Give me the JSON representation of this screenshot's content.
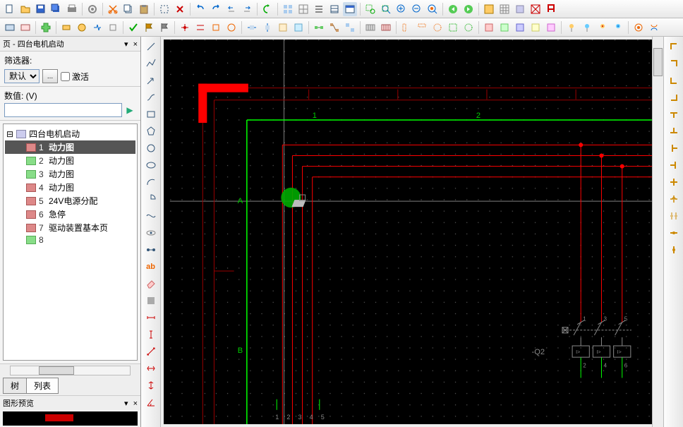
{
  "sidebar": {
    "panel_title": "页 - 四台电机启动",
    "filter_label": "筛选器:",
    "filter_select": "默认",
    "activate_label": "激活",
    "value_label": "数值: (V)",
    "value_input": "",
    "project_name": "四台电机启动",
    "pages": [
      {
        "num": "1",
        "name": "动力图"
      },
      {
        "num": "2",
        "name": "动力图"
      },
      {
        "num": "3",
        "name": "动力图"
      },
      {
        "num": "4",
        "name": "动力图"
      },
      {
        "num": "5",
        "name": "24V电源分配"
      },
      {
        "num": "6",
        "name": "急停"
      },
      {
        "num": "7",
        "name": "驱动装置基本页"
      },
      {
        "num": "8",
        "name": ""
      }
    ],
    "tab_tree": "树",
    "tab_list": "列表",
    "preview_title": "图形预览"
  },
  "canvas": {
    "col_labels": [
      "1",
      "2"
    ],
    "row_labels": [
      "A",
      "B"
    ],
    "bottom_labels": [
      "1",
      "2",
      "3",
      "4",
      "5"
    ],
    "component_ref": "-Q2",
    "terminal_labels": [
      "1",
      "3",
      "5"
    ],
    "terminal_bottom": [
      "2",
      "4",
      "6"
    ],
    "overload": [
      "I>",
      "I>",
      "I>"
    ]
  },
  "icons": {
    "close": "×",
    "pin": "▾",
    "play": "▶",
    "expand": "⊟",
    "collapse": "⊞"
  },
  "colors": {
    "green_wire": "#00ff00",
    "red_wire": "#ff0000",
    "dark_red": "#800000",
    "grid_dot": "#444",
    "crosshair": "#ccc"
  }
}
